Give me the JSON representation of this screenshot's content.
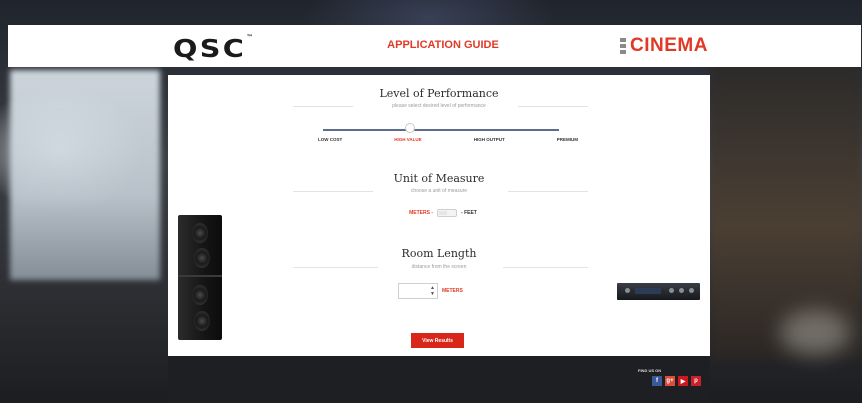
{
  "header": {
    "logo_text": "QSC",
    "logo_mark": "™",
    "title": "APPLICATION GUIDE",
    "brand": "CINEMA"
  },
  "performance": {
    "title": "Level of Performance",
    "subtitle": "please select desired level of performance",
    "options": [
      "LOW COST",
      "HIGH VALUE",
      "HIGH OUTPUT",
      "PREMIUM"
    ],
    "selected": "HIGH VALUE"
  },
  "unit": {
    "title": "Unit of Measure",
    "subtitle": "choose a unit of measure",
    "left_label": "METERS -",
    "right_label": "- FEET",
    "selected": "METERS"
  },
  "room": {
    "title": "Room Length",
    "subtitle": "distance from the screen",
    "value": "",
    "unit": "METERS"
  },
  "actions": {
    "view_results": "View Results"
  },
  "footer": {
    "find_us": "FIND US ON",
    "social": [
      {
        "icon": "facebook-icon",
        "glyph": "f",
        "color": "#3b5998"
      },
      {
        "icon": "google-plus-icon",
        "glyph": "g+",
        "color": "#dd4b39"
      },
      {
        "icon": "youtube-icon",
        "glyph": "▶",
        "color": "#cc181e"
      },
      {
        "icon": "pinterest-icon",
        "glyph": "p",
        "color": "#cb2027"
      }
    ]
  },
  "colors": {
    "accent": "#e03a26",
    "button": "#d8261a",
    "slider_track": "#5b6c8d"
  }
}
